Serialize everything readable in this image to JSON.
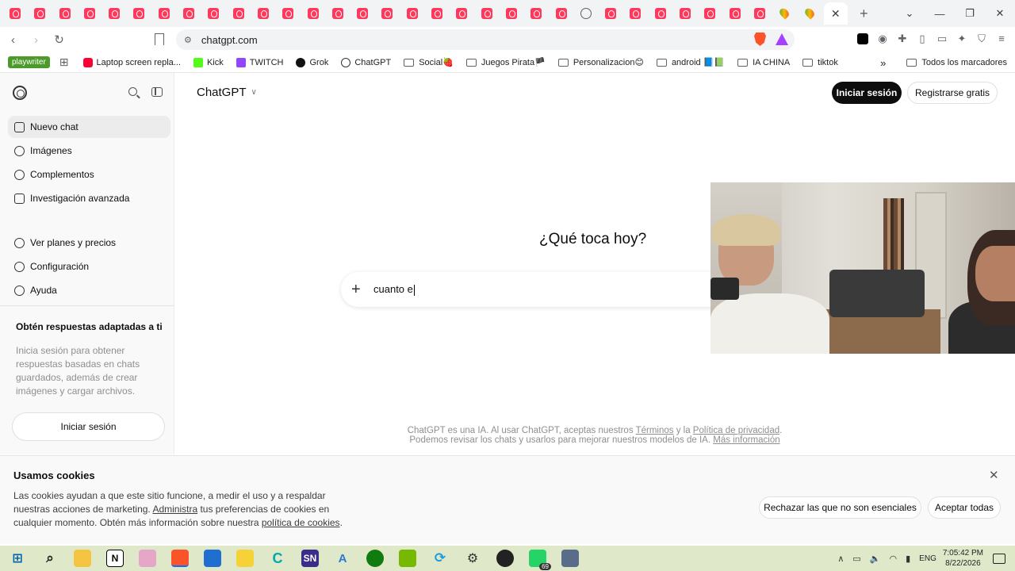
{
  "browser": {
    "url": "chatgpt.com",
    "tab_count_airbnb_like": 31,
    "colors": {
      "tab_favicon": "#ff385c",
      "brave": "#fb542b"
    }
  },
  "bookmarks": {
    "items": [
      {
        "label": "playwriter",
        "kind": "badge"
      },
      {
        "label": "Laptop screen repla...",
        "kind": "youtube"
      },
      {
        "label": "Kick",
        "kind": "kick"
      },
      {
        "label": "TWITCH",
        "kind": "twitch"
      },
      {
        "label": "Grok",
        "kind": "grok"
      },
      {
        "label": "ChatGPT",
        "kind": "chatgpt"
      },
      {
        "label": "Social🍓",
        "kind": "folder"
      },
      {
        "label": "Juegos Pirata🏴",
        "kind": "folder"
      },
      {
        "label": "Personalizacion😊",
        "kind": "folder"
      },
      {
        "label": "android 📘📗",
        "kind": "folder"
      },
      {
        "label": "IA CHINA",
        "kind": "folder"
      },
      {
        "label": "tiktok",
        "kind": "folder"
      }
    ],
    "more": "»",
    "all_bookmarks": "Todos los marcadores"
  },
  "sidebar": {
    "items": [
      {
        "label": "Nuevo chat",
        "icon": "edit-icon"
      },
      {
        "label": "Imágenes",
        "icon": "images-icon"
      },
      {
        "label": "Complementos",
        "icon": "apps-icon"
      },
      {
        "label": "Investigación avanzada",
        "icon": "telescope-icon"
      },
      {
        "label": "Ver planes y precios",
        "icon": "plans-icon"
      },
      {
        "label": "Configuración",
        "icon": "gear-icon"
      },
      {
        "label": "Ayuda",
        "icon": "help-icon"
      }
    ],
    "promo_title": "Obtén respuestas adaptadas a ti",
    "promo_text": "Inicia sesión para obtener respuestas basadas en chats guardados, además de crear imágenes y cargar archivos.",
    "login_label": "Iniciar sesión"
  },
  "header": {
    "title": "ChatGPT",
    "login": "Iniciar sesión",
    "signup": "Registrarse gratis"
  },
  "main": {
    "headline": "¿Qué toca hoy?",
    "composer_value": "cuanto e",
    "disclaimer_a": "ChatGPT es una IA. Al usar ChatGPT, aceptas nuestros ",
    "disclaimer_terms": "Términos",
    "disclaimer_b": " y la ",
    "disclaimer_privacy": "Política de privacidad",
    "disclaimer_c": ".",
    "disclaimer_d": "Podemos revisar los chats y usarlos para mejorar nuestros modelos de IA. ",
    "disclaimer_more": "Más información"
  },
  "cookies": {
    "title": "Usamos cookies",
    "text_a": "Las cookies ayudan a que este sitio funcione, a medir el uso y a respaldar nuestras acciones de marketing. ",
    "text_manage": "Administra",
    "text_b": " tus preferencias de cookies en cualquier momento. Obtén más información sobre nuestra ",
    "text_policy": "política de cookies",
    "text_c": ".",
    "reject": "Rechazar las que no son esenciales",
    "accept": "Aceptar todas"
  },
  "taskbar": {
    "lang": "ENG",
    "time": "7:05:42 PM",
    "date": "8/22/2026",
    "whatsapp_badge": "69"
  }
}
